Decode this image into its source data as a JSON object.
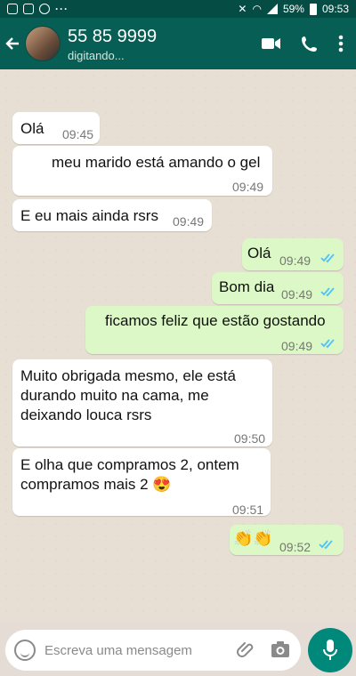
{
  "statusbar": {
    "battery_pct": "59%",
    "clock": "09:53"
  },
  "header": {
    "contact_name": "55 85 9999",
    "contact_status": "digitando..."
  },
  "messages": [
    {
      "dir": "in",
      "text": "Olá",
      "time": "09:45"
    },
    {
      "dir": "in",
      "text": "meu marido está amando o gel",
      "time": "09:49"
    },
    {
      "dir": "in",
      "text": "E eu mais ainda rsrs",
      "time": "09:49"
    },
    {
      "dir": "out",
      "text": "Olá",
      "time": "09:49",
      "read": true
    },
    {
      "dir": "out",
      "text": "Bom dia",
      "time": "09:49",
      "read": true
    },
    {
      "dir": "out",
      "text": "ficamos feliz que estão gostando",
      "time": "09:49",
      "read": true
    },
    {
      "dir": "in",
      "text_lines": [
        "Muito obrigada mesmo, ele está",
        "durando muito na cama, me",
        "deixando louca rsrs"
      ],
      "time": "09:50"
    },
    {
      "dir": "in",
      "text_lines": [
        "E olha que compramos 2, ontem",
        "compramos mais 2 😍"
      ],
      "time": "09:51"
    },
    {
      "dir": "out",
      "text": "👏👏",
      "time": "09:52",
      "read": true
    }
  ],
  "input": {
    "placeholder": "Escreva uma mensagem"
  },
  "colors": {
    "header": "#075e54",
    "statusbar": "#054d44",
    "outgoing_bubble": "#dcf8c6",
    "incoming_bubble": "#ffffff",
    "read_ticks": "#4fc3f7",
    "mic_button": "#00897b"
  },
  "icons": [
    "back-arrow-icon",
    "video-call-icon",
    "phone-icon",
    "menu-dots-icon",
    "emoji-icon",
    "attach-icon",
    "camera-icon",
    "mic-icon"
  ]
}
